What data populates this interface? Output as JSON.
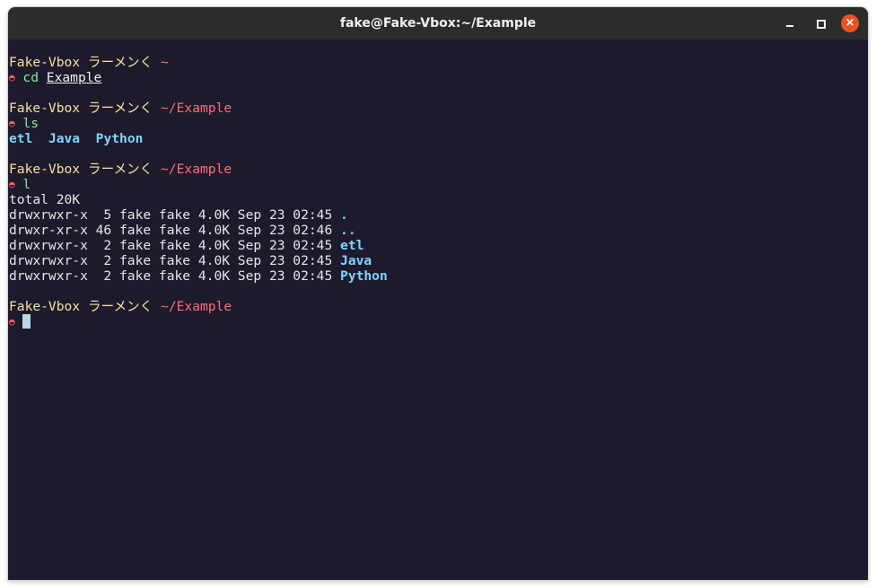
{
  "window": {
    "title": "fake@Fake-Vbox:~/Example",
    "buttons": {
      "minimize": "minimize",
      "maximize": "maximize",
      "close": "×"
    }
  },
  "colors": {
    "background": "#1d1a2b",
    "host": "#f4e1a6",
    "path": "#ff6b7a",
    "command": "#8ae6a0",
    "directory": "#7fd3ff",
    "close_button": "#e95420"
  },
  "prompt": {
    "host": "Fake-Vbox ラーメンく",
    "symbol": "◓"
  },
  "session": {
    "block1": {
      "path": "~",
      "command": "cd",
      "arg": "Example"
    },
    "block2": {
      "path": "~/Example",
      "command": "ls",
      "output": [
        "etl",
        "Java",
        "Python"
      ]
    },
    "block3": {
      "path": "~/Example",
      "command": "l",
      "total": "total 20K",
      "rows": [
        {
          "meta": "drwxrwxr-x  5 fake fake 4.0K Sep 23 02:45 ",
          "name": "."
        },
        {
          "meta": "drwxr-xr-x 46 fake fake 4.0K Sep 23 02:46 ",
          "name": ".."
        },
        {
          "meta": "drwxrwxr-x  2 fake fake 4.0K Sep 23 02:45 ",
          "name": "etl"
        },
        {
          "meta": "drwxrwxr-x  2 fake fake 4.0K Sep 23 02:45 ",
          "name": "Java"
        },
        {
          "meta": "drwxrwxr-x  2 fake fake 4.0K Sep 23 02:45 ",
          "name": "Python"
        }
      ]
    },
    "block4": {
      "path": "~/Example"
    }
  }
}
